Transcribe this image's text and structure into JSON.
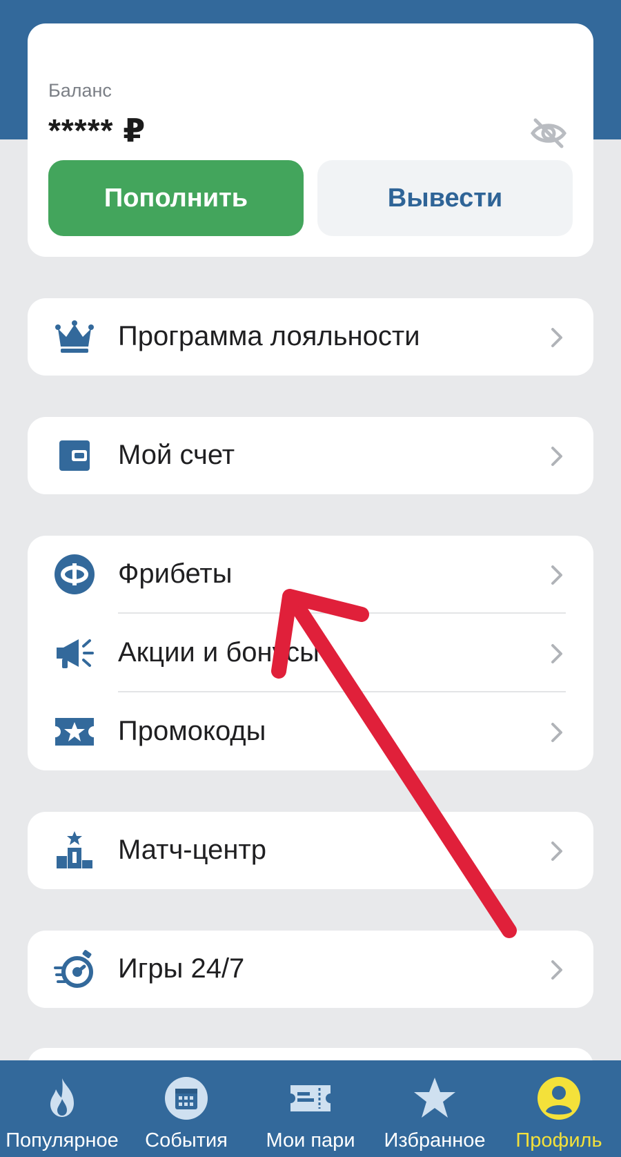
{
  "balance": {
    "label": "Баланс",
    "value": "***** ₽",
    "deposit_label": "Пополнить",
    "withdraw_label": "Вывести"
  },
  "menu": {
    "loyalty": "Программа лояльности",
    "account": "Мой счет",
    "freebets": "Фрибеты",
    "promotions": "Акции и бонусы",
    "promocodes": "Промокоды",
    "match_center": "Матч-центр",
    "games": "Игры 24/7"
  },
  "tabbar": {
    "popular": "Популярное",
    "events": "События",
    "my_bets": "Мои пари",
    "favorites": "Избранное",
    "profile": "Профиль"
  },
  "colors": {
    "brand_blue": "#33699b",
    "deposit_green": "#43a55c",
    "active_tab": "#f4e13a",
    "annotation_arrow": "#e0203a"
  }
}
